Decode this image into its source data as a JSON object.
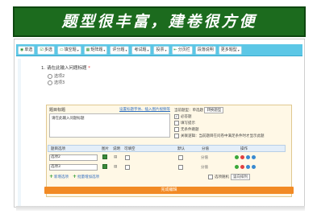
{
  "banner": {
    "title": "题型很丰富，建卷很方便"
  },
  "toolbar": {
    "buttons": [
      {
        "label": "单选",
        "icon": "radio-icon",
        "caret": false
      },
      {
        "label": "多选",
        "icon": "checkbox-icon",
        "caret": false
      },
      {
        "label": "填空题",
        "icon": "fill-icon",
        "caret": true
      },
      {
        "label": "矩阵题",
        "icon": "matrix-icon",
        "caret": true
      },
      {
        "label": "评分题",
        "icon": "rating-icon",
        "caret": true
      },
      {
        "label": "考试题",
        "icon": "exam-icon",
        "caret": true
      },
      {
        "label": "投票",
        "icon": "vote-icon",
        "caret": true
      },
      {
        "label": "分页栏",
        "icon": "page-break-icon",
        "caret": false
      },
      {
        "label": "段落说明",
        "icon": "paragraph-icon",
        "caret": false
      },
      {
        "label": "更多题型",
        "icon": "more-icon",
        "caret": true
      }
    ]
  },
  "question": {
    "number": "1.",
    "title": "请在此输入问题标题",
    "required_mark": "*",
    "options": [
      "选项2",
      "选项3"
    ]
  },
  "editor": {
    "header": "题目标题",
    "links": "设置标题字体、插入图片视频等",
    "textarea_value": "请在此输入问题标题",
    "type_label": "当前题型：单选题",
    "type_select": "转换题型",
    "checks": [
      {
        "label": "必答题",
        "checked": true
      },
      {
        "label": "填写提示",
        "checked": false
      },
      {
        "label": "无条件跳题",
        "checked": false
      },
      {
        "label": "关联逻辑：当前题目在问卷中满足条件时才显示此题",
        "checked": false
      }
    ],
    "table_headers": [
      "题目选项",
      "图片",
      "说明",
      "可填空",
      "默认",
      "分值",
      "操作"
    ],
    "table_extra_header": "分值",
    "rows": [
      {
        "value": "选项2",
        "score": "分值"
      },
      {
        "value": "选项3",
        "score": "分值"
      }
    ],
    "add_option": "新增选项",
    "batch_add": "批量增加选项",
    "score_toggle": "选项随机",
    "score_select": "竖向排列",
    "done_label": "完成编辑"
  }
}
